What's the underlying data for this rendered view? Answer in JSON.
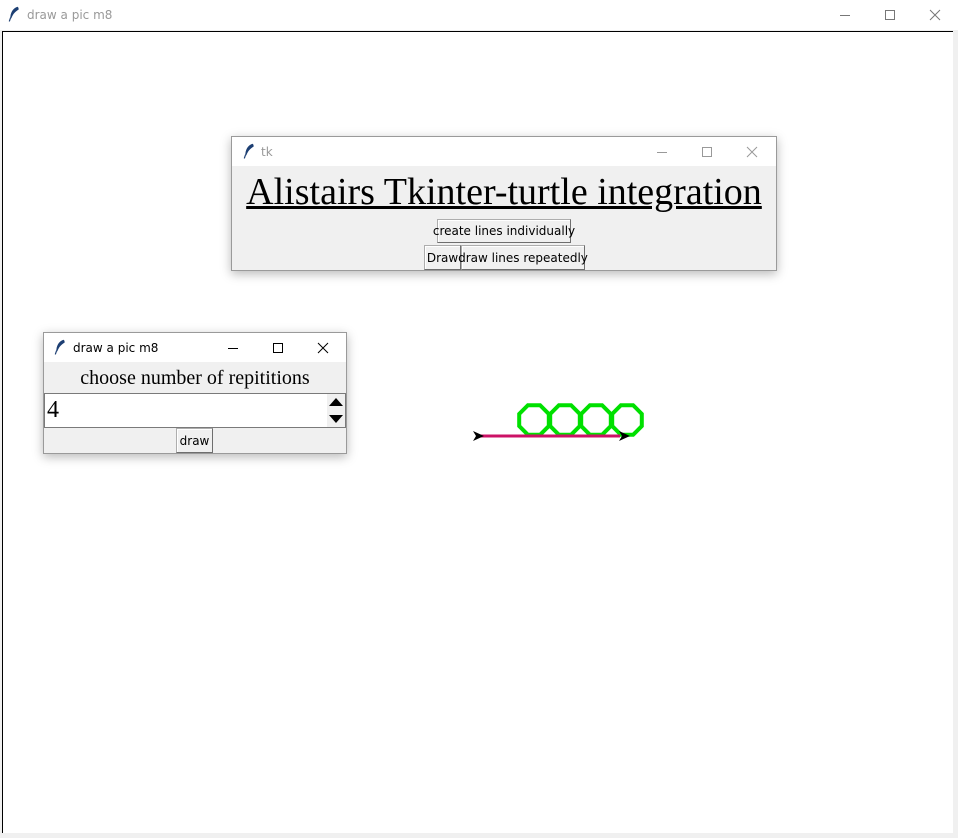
{
  "main_window": {
    "title": "draw a pic m8"
  },
  "tk_window": {
    "title": "tk",
    "heading": "Alistairs Tkinter-turtle integration",
    "buttons": {
      "create_lines": "create lines individually",
      "draw": "Draw",
      "draw_repeat": "draw lines repeatedly"
    }
  },
  "reps_window": {
    "title": "draw a pic m8",
    "prompt": "choose number of repititions",
    "value": "4",
    "draw_button": "draw"
  },
  "drawing": {
    "ring_count": 4,
    "ring_color": "#00e000",
    "line_color": "#cc1166",
    "turtle_color": "#000000"
  },
  "colors": {
    "titlebar_bg": "#ffffff",
    "title_text": "#999999",
    "window_bg": "#f0f0f0",
    "canvas_bg": "#ffffff"
  }
}
